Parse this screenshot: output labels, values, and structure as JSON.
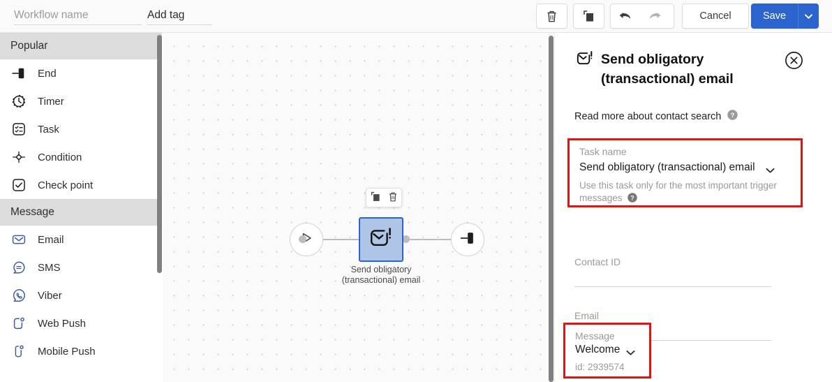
{
  "topbar": {
    "workflow_name_value": "",
    "workflow_name_placeholder": "Workflow name",
    "add_tag_value": "",
    "add_tag_placeholder": "Add tag",
    "delete_icon": "trash-icon",
    "copy_icon": "copy-icon",
    "undo_icon": "undo-arrow-icon",
    "redo_icon": "redo-arrow-icon",
    "cancel_label": "Cancel",
    "save_label": "Save",
    "save_caret_icon": "chevron-down-icon",
    "accent_color": "#2b64cf"
  },
  "sidebar": {
    "sections": [
      {
        "title": "Popular",
        "items": [
          {
            "label": "End",
            "icon": "end-node-icon"
          },
          {
            "label": "Timer",
            "icon": "timer-clock-icon"
          },
          {
            "label": "Task",
            "icon": "task-checklist-icon"
          },
          {
            "label": "Condition",
            "icon": "condition-diamond-icon"
          },
          {
            "label": "Check point",
            "icon": "check-point-icon"
          }
        ]
      },
      {
        "title": "Message",
        "items": [
          {
            "label": "Email",
            "icon": "email-envelope-icon"
          },
          {
            "label": "SMS",
            "icon": "sms-bubble-icon"
          },
          {
            "label": "Viber",
            "icon": "viber-icon"
          },
          {
            "label": "Web Push",
            "icon": "web-push-icon"
          },
          {
            "label": "Mobile Push",
            "icon": "mobile-push-icon"
          }
        ]
      }
    ],
    "header_bg": "#dcdcdc",
    "message_icon_color": "#3f5d9e"
  },
  "canvas": {
    "start_node_icon": "play-triangle-icon",
    "end_node_icon": "end-node-icon",
    "selected_node": {
      "icon": "obligatory-email-icon",
      "label_line1": "Send obligatory",
      "label_line2": "(transactional) email",
      "fill_color": "#aec5e8",
      "border_color": "#2b64cf"
    },
    "node_toolbar": {
      "copy_icon": "copy-icon",
      "delete_icon": "trash-icon"
    }
  },
  "panel": {
    "icon": "obligatory-email-icon",
    "title_line1": "Send obligatory",
    "title_line2": "(transactional) email",
    "close_icon": "close-circle-icon",
    "read_more_text": "Read more about contact search",
    "read_more_help_icon": "help-question-icon",
    "task_field": {
      "label": "Task name",
      "value": "Send obligatory (transactional) email",
      "caret_icon": "chevron-down-icon",
      "hint": "Use this task only for the most important trigger messages",
      "hint_help_icon": "help-question-icon",
      "highlight_color": "#e21313"
    },
    "contact_field": {
      "label": "Contact ID",
      "value": ""
    },
    "email_field": {
      "label": "Email",
      "value": ""
    },
    "message_field": {
      "label": "Message",
      "value": "Welcome",
      "caret_icon": "chevron-down-icon",
      "id_text": "id: 2939574",
      "highlight_color": "#e21313"
    }
  }
}
